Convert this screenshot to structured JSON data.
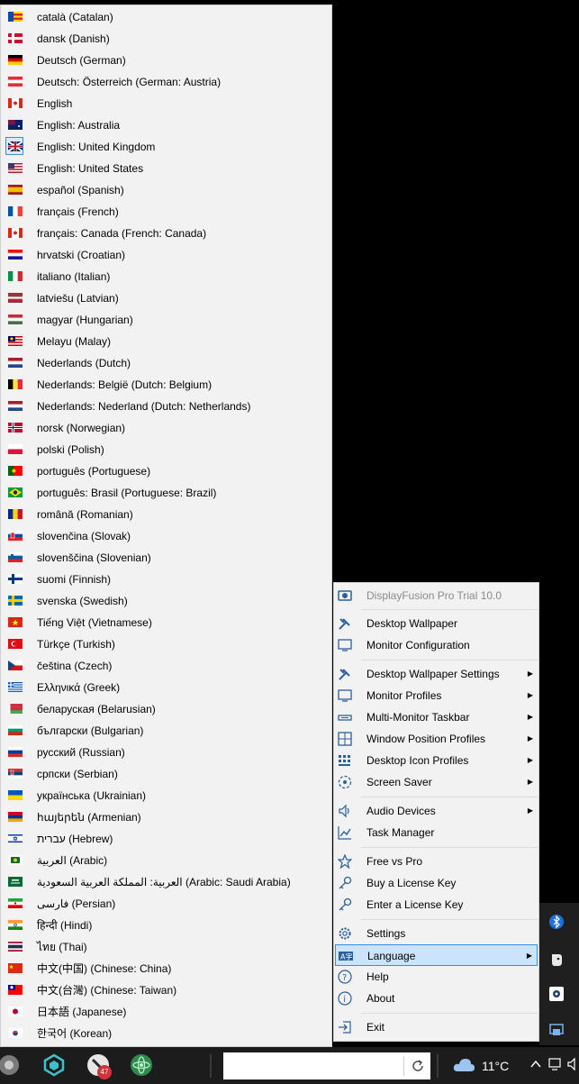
{
  "language_menu": {
    "items": [
      {
        "label": "català (Catalan)",
        "flag": "catalan-flag-icon"
      },
      {
        "label": "dansk (Danish)",
        "flag": "denmark-flag-icon"
      },
      {
        "label": "Deutsch (German)",
        "flag": "germany-flag-icon"
      },
      {
        "label": "Deutsch: Österreich (German: Austria)",
        "flag": "austria-flag-icon"
      },
      {
        "label": "English",
        "flag": "canada-flag-icon"
      },
      {
        "label": "English: Australia",
        "flag": "australia-flag-icon"
      },
      {
        "label": "English: United Kingdom",
        "flag": "uk-flag-icon",
        "checked": true
      },
      {
        "label": "English: United States",
        "flag": "usa-flag-icon"
      },
      {
        "label": "español (Spanish)",
        "flag": "spain-flag-icon"
      },
      {
        "label": "français (French)",
        "flag": "france-flag-icon"
      },
      {
        "label": "français: Canada (French: Canada)",
        "flag": "canada-flag-icon"
      },
      {
        "label": "hrvatski (Croatian)",
        "flag": "croatia-flag-icon"
      },
      {
        "label": "italiano (Italian)",
        "flag": "italy-flag-icon"
      },
      {
        "label": "latviešu (Latvian)",
        "flag": "latvia-flag-icon"
      },
      {
        "label": "magyar (Hungarian)",
        "flag": "hungary-flag-icon"
      },
      {
        "label": "Melayu (Malay)",
        "flag": "malaysia-flag-icon"
      },
      {
        "label": "Nederlands (Dutch)",
        "flag": "netherlands-flag-icon"
      },
      {
        "label": "Nederlands: België (Dutch: Belgium)",
        "flag": "belgium-flag-icon"
      },
      {
        "label": "Nederlands: Nederland (Dutch: Netherlands)",
        "flag": "netherlands-flag-icon"
      },
      {
        "label": "norsk (Norwegian)",
        "flag": "norway-flag-icon"
      },
      {
        "label": "polski (Polish)",
        "flag": "poland-flag-icon"
      },
      {
        "label": "português (Portuguese)",
        "flag": "portugal-flag-icon"
      },
      {
        "label": "português: Brasil (Portuguese: Brazil)",
        "flag": "brazil-flag-icon"
      },
      {
        "label": "română (Romanian)",
        "flag": "romania-flag-icon"
      },
      {
        "label": "slovenčina (Slovak)",
        "flag": "slovakia-flag-icon"
      },
      {
        "label": "slovenščina (Slovenian)",
        "flag": "slovenia-flag-icon"
      },
      {
        "label": "suomi (Finnish)",
        "flag": "finland-flag-icon"
      },
      {
        "label": "svenska (Swedish)",
        "flag": "sweden-flag-icon"
      },
      {
        "label": "Tiếng Việt (Vietnamese)",
        "flag": "vietnam-flag-icon"
      },
      {
        "label": "Türkçe (Turkish)",
        "flag": "turkey-flag-icon"
      },
      {
        "label": "čeština (Czech)",
        "flag": "czech-flag-icon"
      },
      {
        "label": "Ελληνικά (Greek)",
        "flag": "greece-flag-icon"
      },
      {
        "label": "беларуская (Belarusian)",
        "flag": "belarus-flag-icon"
      },
      {
        "label": "български (Bulgarian)",
        "flag": "bulgaria-flag-icon"
      },
      {
        "label": "русский (Russian)",
        "flag": "russia-flag-icon"
      },
      {
        "label": "српски (Serbian)",
        "flag": "serbia-flag-icon"
      },
      {
        "label": "українська (Ukrainian)",
        "flag": "ukraine-flag-icon"
      },
      {
        "label": "հայերեն (Armenian)",
        "flag": "armenia-flag-icon"
      },
      {
        "label": "עברית (Hebrew)",
        "flag": "israel-flag-icon"
      },
      {
        "label": "العربية (Arabic)",
        "flag": "arabic-flag-icon"
      },
      {
        "label": "العربية: المملكة العربية السعودية (Arabic: Saudi Arabia)",
        "flag": "saudi-arabia-flag-icon"
      },
      {
        "label": "فارسی (Persian)",
        "flag": "iran-flag-icon"
      },
      {
        "label": "हिन्दी (Hindi)",
        "flag": "india-flag-icon"
      },
      {
        "label": "ไทย (Thai)",
        "flag": "thailand-flag-icon"
      },
      {
        "label": "中文(中国) (Chinese: China)",
        "flag": "china-flag-icon"
      },
      {
        "label": "中文(台灣) (Chinese: Taiwan)",
        "flag": "taiwan-flag-icon"
      },
      {
        "label": "日本語 (Japanese)",
        "flag": "japan-flag-icon"
      },
      {
        "label": "한국어 (Korean)",
        "flag": "korea-flag-icon"
      }
    ]
  },
  "context_menu": {
    "title": "DisplayFusion Pro Trial 10.0",
    "desktop_wallpaper": "Desktop Wallpaper",
    "monitor_configuration": "Monitor Configuration",
    "desktop_wallpaper_settings": "Desktop Wallpaper Settings",
    "monitor_profiles": "Monitor Profiles",
    "multi_monitor_taskbar": "Multi-Monitor Taskbar",
    "window_position_profiles": "Window Position Profiles",
    "desktop_icon_profiles": "Desktop Icon Profiles",
    "screen_saver": "Screen Saver",
    "audio_devices": "Audio Devices",
    "task_manager": "Task Manager",
    "free_vs_pro": "Free vs Pro",
    "buy_license": "Buy a License Key",
    "enter_license": "Enter a License Key",
    "settings": "Settings",
    "language": "Language",
    "help": "Help",
    "about": "About",
    "exit": "Exit",
    "submenu_arrow": "▶"
  },
  "taskbar": {
    "badge_count": "47",
    "temperature": "11°C"
  },
  "colors": {
    "menu_bg": "#f2f2f2",
    "highlight": "#cce4fb",
    "highlight_border": "#2f8fe6",
    "taskbar_bg": "#1c1c1c"
  }
}
